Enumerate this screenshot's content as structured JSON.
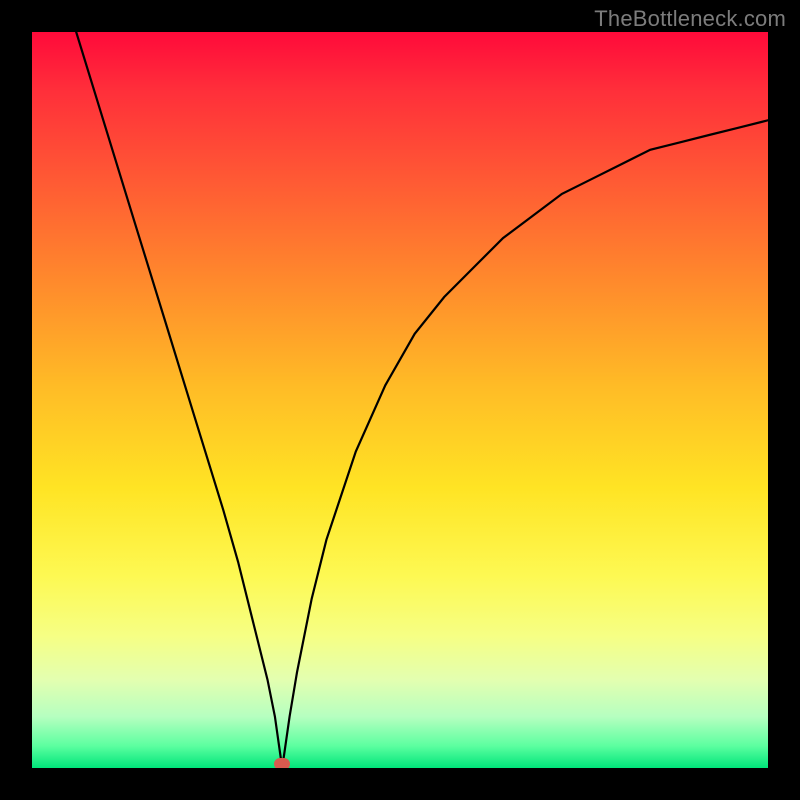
{
  "watermark": "TheBottleneck.com",
  "colors": {
    "frame": "#000000",
    "curve": "#000000",
    "marker": "#d85a4f",
    "gradient_top": "#ff0a3a",
    "gradient_bottom": "#00e57a"
  },
  "chart_data": {
    "type": "line",
    "title": "",
    "xlabel": "",
    "ylabel": "",
    "xlim": [
      0,
      100
    ],
    "ylim": [
      0,
      100
    ],
    "grid": false,
    "legend": false,
    "annotations": [
      "TheBottleneck.com"
    ],
    "marker": {
      "x": 34,
      "y": 0
    },
    "series": [
      {
        "name": "curve",
        "x": [
          6,
          10,
          14,
          18,
          22,
          26,
          28,
          30,
          32,
          33,
          34,
          35,
          36,
          38,
          40,
          44,
          48,
          52,
          56,
          60,
          64,
          68,
          72,
          76,
          80,
          84,
          88,
          92,
          96,
          100
        ],
        "values": [
          100,
          87,
          74,
          61,
          48,
          35,
          28,
          20,
          12,
          7,
          0,
          7,
          13,
          23,
          31,
          43,
          52,
          59,
          64,
          68,
          72,
          75,
          78,
          80,
          82,
          84,
          85,
          86,
          87,
          88
        ]
      }
    ]
  }
}
